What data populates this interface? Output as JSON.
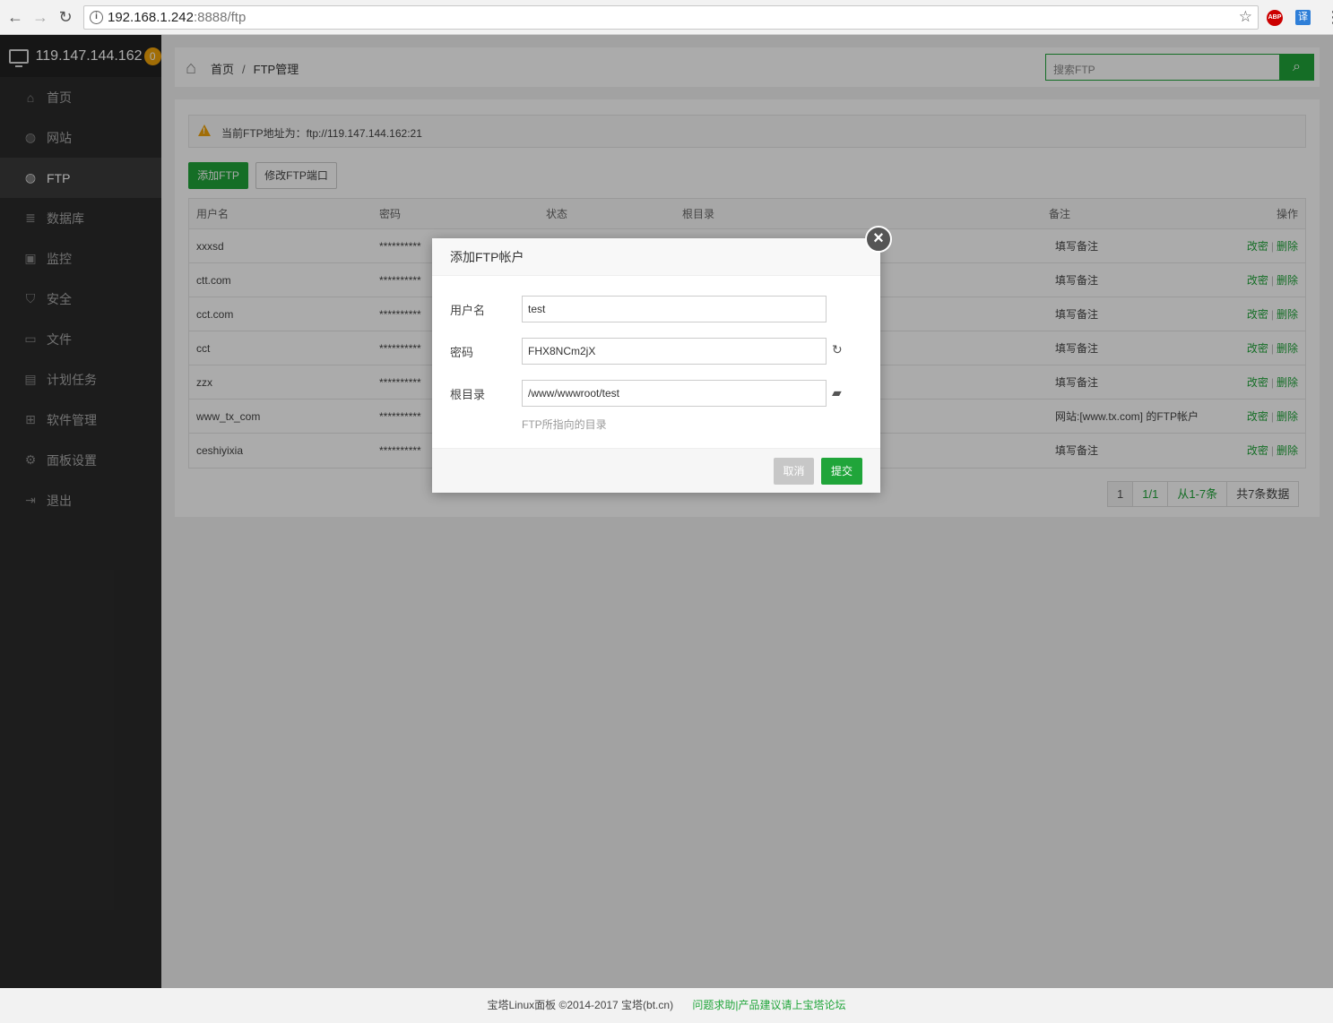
{
  "browser": {
    "url_host": "192.168.1.242",
    "url_path": ":8888/ftp",
    "ext_abp": "ABP",
    "ext_translate": "译"
  },
  "sidebar": {
    "server_ip": "119.147.144.162",
    "badge_count": "0",
    "items": [
      {
        "label": "首页",
        "icon": "home-icon"
      },
      {
        "label": "网站",
        "icon": "globe-icon"
      },
      {
        "label": "FTP",
        "icon": "ftp-icon"
      },
      {
        "label": "数据库",
        "icon": "database-icon"
      },
      {
        "label": "监控",
        "icon": "monitor-icon"
      },
      {
        "label": "安全",
        "icon": "shield-icon"
      },
      {
        "label": "文件",
        "icon": "folder-icon"
      },
      {
        "label": "计划任务",
        "icon": "calendar-icon"
      },
      {
        "label": "软件管理",
        "icon": "grid-icon"
      },
      {
        "label": "面板设置",
        "icon": "gear-icon"
      },
      {
        "label": "退出",
        "icon": "logout-icon"
      }
    ],
    "active_index": 2
  },
  "breadcrumb": {
    "home": "首页",
    "current": "FTP管理"
  },
  "search": {
    "placeholder": "搜索FTP"
  },
  "alert": {
    "message": "当前FTP地址为：ftp://119.147.144.162:21"
  },
  "toolbar": {
    "add_label": "添加FTP",
    "port_label": "修改FTP端口"
  },
  "table": {
    "headers": [
      "用户名",
      "密码",
      "状态",
      "根目录",
      "备注",
      "操作"
    ],
    "rows": [
      {
        "user": "xxxsd",
        "password": "**********",
        "note": "填写备注"
      },
      {
        "user": "ctt.com",
        "password": "**********",
        "note": "填写备注"
      },
      {
        "user": "cct.com",
        "password": "**********",
        "note": "填写备注"
      },
      {
        "user": "cct",
        "password": "**********",
        "note": "填写备注"
      },
      {
        "user": "zzx",
        "password": "**********",
        "note": "填写备注"
      },
      {
        "user": "www_tx_com",
        "password": "**********",
        "note": "网站:[www.tx.com] 的FTP帐户"
      },
      {
        "user": "ceshiyixia",
        "password": "**********",
        "note": "填写备注"
      }
    ],
    "op_edit": "改密",
    "op_sep": "|",
    "op_delete": "删除"
  },
  "pager": {
    "page": "1",
    "pages": "1/1",
    "range": "从1-7条",
    "total": "共7条数据"
  },
  "modal": {
    "title": "添加FTP帐户",
    "username_label": "用户名",
    "username_value": "test",
    "password_label": "密码",
    "password_value": "FHX8NCm2jX",
    "rootdir_label": "根目录",
    "rootdir_value": "/www/wwwroot/test",
    "rootdir_hint": "FTP所指向的目录",
    "cancel_label": "取消",
    "submit_label": "提交"
  },
  "footer": {
    "copyright": "宝塔Linux面板 ©2014-2017 宝塔(bt.cn)",
    "forum_link": "问题求助|产品建议请上宝塔论坛"
  },
  "colors": {
    "accent": "#20a53a",
    "sidebar_bg": "#2b2b2b",
    "badge": "#f0a30a"
  }
}
